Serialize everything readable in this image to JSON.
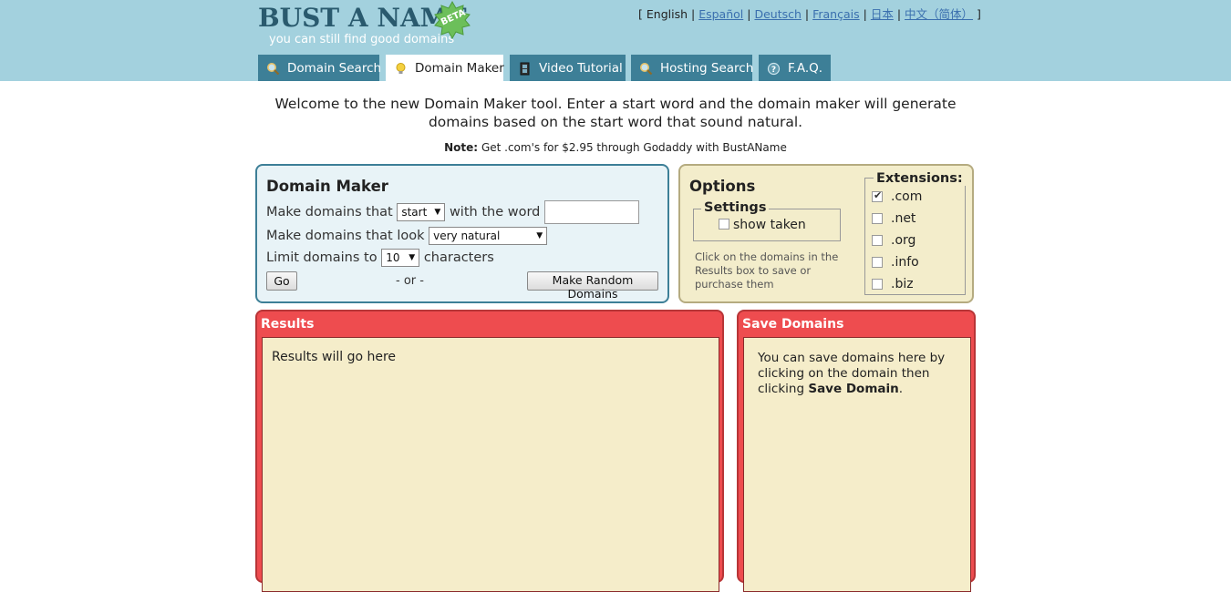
{
  "brand": {
    "title": "BUST A NAME",
    "tagline": "you can still find good domains",
    "badge": "BETA"
  },
  "languages": {
    "open_bracket": "[",
    "close_bracket": "]",
    "sep": "|",
    "items": [
      "English",
      "Español",
      "Deutsch",
      "Français",
      "日本",
      "中文（简体）"
    ]
  },
  "tabs": [
    {
      "label": "Domain Search",
      "icon": "magnifier-icon"
    },
    {
      "label": "Domain Maker",
      "icon": "lightbulb-icon"
    },
    {
      "label": "Video Tutorial",
      "icon": "film-icon"
    },
    {
      "label": "Hosting Search",
      "icon": "magnifier-icon"
    },
    {
      "label": "F.A.Q.",
      "icon": "question-icon"
    }
  ],
  "intro": "Welcome to the new Domain Maker tool. Enter a start word and the domain maker will generate domains based on the start word that sound natural.",
  "note": {
    "label": "Note:",
    "text": "Get .com's for $2.95 through Godaddy with BustAName"
  },
  "maker": {
    "title": "Domain Maker",
    "row1_prefix": "Make domains that",
    "row1_select": "start",
    "row1_suffix": "with the word",
    "word_value": "",
    "row2_prefix": "Make domains that look",
    "row2_select": "very natural",
    "row3_prefix": "Limit domains to",
    "row3_select": "10",
    "row3_suffix": "characters",
    "go_label": "Go",
    "or_label": "- or -",
    "random_label": "Make Random Domains"
  },
  "options": {
    "title": "Options",
    "settings_legend": "Settings",
    "show_taken_label": "show taken",
    "help": "Click on the domains in the Results box to save or purchase them",
    "extensions_legend": "Extensions:",
    "extensions": [
      {
        "label": ".com",
        "checked": true
      },
      {
        "label": ".net",
        "checked": false
      },
      {
        "label": ".org",
        "checked": false
      },
      {
        "label": ".info",
        "checked": false
      },
      {
        "label": ".biz",
        "checked": false
      }
    ]
  },
  "results": {
    "title": "Results",
    "placeholder": "Results will go here"
  },
  "save": {
    "title": "Save Domains",
    "text_before": "You can save domains here by clicking on the domain then clicking",
    "bold": "Save Domain",
    "text_after": "."
  },
  "colors": {
    "header_bg": "#a3d1de",
    "tab_bg": "#3d7f97",
    "results_border": "#ee4c4f",
    "panel_cream": "#f5edca"
  }
}
